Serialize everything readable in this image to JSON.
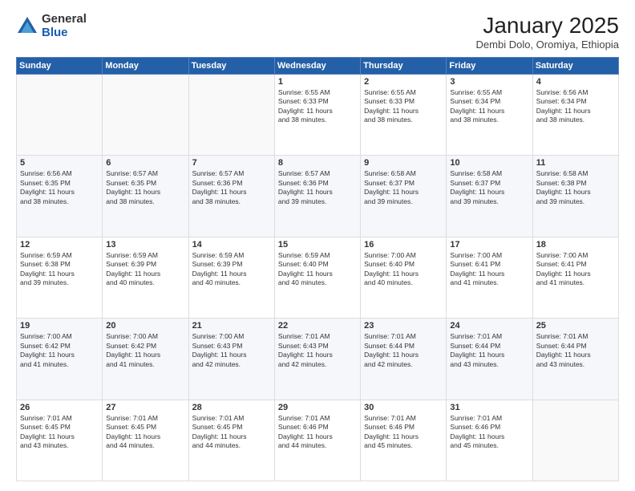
{
  "logo": {
    "general": "General",
    "blue": "Blue"
  },
  "header": {
    "month": "January 2025",
    "location": "Dembi Dolo, Oromiya, Ethiopia"
  },
  "weekdays": [
    "Sunday",
    "Monday",
    "Tuesday",
    "Wednesday",
    "Thursday",
    "Friday",
    "Saturday"
  ],
  "weeks": [
    [
      {
        "day": "",
        "info": ""
      },
      {
        "day": "",
        "info": ""
      },
      {
        "day": "",
        "info": ""
      },
      {
        "day": "1",
        "info": "Sunrise: 6:55 AM\nSunset: 6:33 PM\nDaylight: 11 hours\nand 38 minutes."
      },
      {
        "day": "2",
        "info": "Sunrise: 6:55 AM\nSunset: 6:33 PM\nDaylight: 11 hours\nand 38 minutes."
      },
      {
        "day": "3",
        "info": "Sunrise: 6:55 AM\nSunset: 6:34 PM\nDaylight: 11 hours\nand 38 minutes."
      },
      {
        "day": "4",
        "info": "Sunrise: 6:56 AM\nSunset: 6:34 PM\nDaylight: 11 hours\nand 38 minutes."
      }
    ],
    [
      {
        "day": "5",
        "info": "Sunrise: 6:56 AM\nSunset: 6:35 PM\nDaylight: 11 hours\nand 38 minutes."
      },
      {
        "day": "6",
        "info": "Sunrise: 6:57 AM\nSunset: 6:35 PM\nDaylight: 11 hours\nand 38 minutes."
      },
      {
        "day": "7",
        "info": "Sunrise: 6:57 AM\nSunset: 6:36 PM\nDaylight: 11 hours\nand 38 minutes."
      },
      {
        "day": "8",
        "info": "Sunrise: 6:57 AM\nSunset: 6:36 PM\nDaylight: 11 hours\nand 39 minutes."
      },
      {
        "day": "9",
        "info": "Sunrise: 6:58 AM\nSunset: 6:37 PM\nDaylight: 11 hours\nand 39 minutes."
      },
      {
        "day": "10",
        "info": "Sunrise: 6:58 AM\nSunset: 6:37 PM\nDaylight: 11 hours\nand 39 minutes."
      },
      {
        "day": "11",
        "info": "Sunrise: 6:58 AM\nSunset: 6:38 PM\nDaylight: 11 hours\nand 39 minutes."
      }
    ],
    [
      {
        "day": "12",
        "info": "Sunrise: 6:59 AM\nSunset: 6:38 PM\nDaylight: 11 hours\nand 39 minutes."
      },
      {
        "day": "13",
        "info": "Sunrise: 6:59 AM\nSunset: 6:39 PM\nDaylight: 11 hours\nand 40 minutes."
      },
      {
        "day": "14",
        "info": "Sunrise: 6:59 AM\nSunset: 6:39 PM\nDaylight: 11 hours\nand 40 minutes."
      },
      {
        "day": "15",
        "info": "Sunrise: 6:59 AM\nSunset: 6:40 PM\nDaylight: 11 hours\nand 40 minutes."
      },
      {
        "day": "16",
        "info": "Sunrise: 7:00 AM\nSunset: 6:40 PM\nDaylight: 11 hours\nand 40 minutes."
      },
      {
        "day": "17",
        "info": "Sunrise: 7:00 AM\nSunset: 6:41 PM\nDaylight: 11 hours\nand 41 minutes."
      },
      {
        "day": "18",
        "info": "Sunrise: 7:00 AM\nSunset: 6:41 PM\nDaylight: 11 hours\nand 41 minutes."
      }
    ],
    [
      {
        "day": "19",
        "info": "Sunrise: 7:00 AM\nSunset: 6:42 PM\nDaylight: 11 hours\nand 41 minutes."
      },
      {
        "day": "20",
        "info": "Sunrise: 7:00 AM\nSunset: 6:42 PM\nDaylight: 11 hours\nand 41 minutes."
      },
      {
        "day": "21",
        "info": "Sunrise: 7:00 AM\nSunset: 6:43 PM\nDaylight: 11 hours\nand 42 minutes."
      },
      {
        "day": "22",
        "info": "Sunrise: 7:01 AM\nSunset: 6:43 PM\nDaylight: 11 hours\nand 42 minutes."
      },
      {
        "day": "23",
        "info": "Sunrise: 7:01 AM\nSunset: 6:44 PM\nDaylight: 11 hours\nand 42 minutes."
      },
      {
        "day": "24",
        "info": "Sunrise: 7:01 AM\nSunset: 6:44 PM\nDaylight: 11 hours\nand 43 minutes."
      },
      {
        "day": "25",
        "info": "Sunrise: 7:01 AM\nSunset: 6:44 PM\nDaylight: 11 hours\nand 43 minutes."
      }
    ],
    [
      {
        "day": "26",
        "info": "Sunrise: 7:01 AM\nSunset: 6:45 PM\nDaylight: 11 hours\nand 43 minutes."
      },
      {
        "day": "27",
        "info": "Sunrise: 7:01 AM\nSunset: 6:45 PM\nDaylight: 11 hours\nand 44 minutes."
      },
      {
        "day": "28",
        "info": "Sunrise: 7:01 AM\nSunset: 6:45 PM\nDaylight: 11 hours\nand 44 minutes."
      },
      {
        "day": "29",
        "info": "Sunrise: 7:01 AM\nSunset: 6:46 PM\nDaylight: 11 hours\nand 44 minutes."
      },
      {
        "day": "30",
        "info": "Sunrise: 7:01 AM\nSunset: 6:46 PM\nDaylight: 11 hours\nand 45 minutes."
      },
      {
        "day": "31",
        "info": "Sunrise: 7:01 AM\nSunset: 6:46 PM\nDaylight: 11 hours\nand 45 minutes."
      },
      {
        "day": "",
        "info": ""
      }
    ]
  ]
}
